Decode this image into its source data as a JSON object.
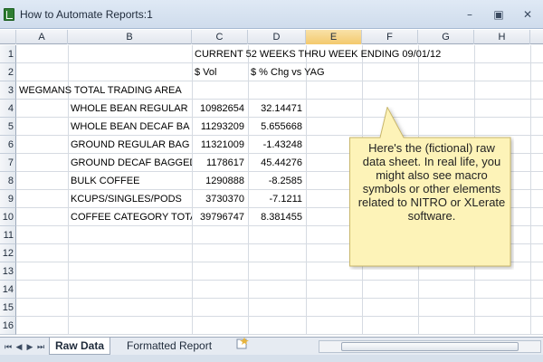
{
  "window": {
    "title": "How to Automate Reports:1",
    "minimize_glyph": "–",
    "restore_glyph": "▣",
    "close_glyph": "✕"
  },
  "columns": [
    "A",
    "B",
    "C",
    "D",
    "E",
    "F",
    "G",
    "H"
  ],
  "selected_column": "E",
  "row_numbers": [
    "1",
    "2",
    "3",
    "4",
    "5",
    "6",
    "7",
    "8",
    "9",
    "10",
    "11",
    "12",
    "13",
    "14",
    "15",
    "16"
  ],
  "cells": {
    "C1": "CURRENT 52 WEEKS THRU WEEK ENDING 09/01/12",
    "C2": "$ Vol",
    "D2": "$ % Chg vs YAG",
    "A3": "WEGMANS TOTAL TRADING AREA",
    "B4": "WHOLE BEAN REGULAR",
    "C4": "10982654",
    "D4": "32.14471",
    "B5": "WHOLE BEAN DECAF BA",
    "C5": "11293209",
    "D5": "5.655668",
    "B6": "GROUND REGULAR BAG",
    "C6": "11321009",
    "D6": "-1.43248",
    "B7": "GROUND DECAF BAGGED",
    "C7": "1178617",
    "D7": "45.44276",
    "B8": "BULK COFFEE",
    "C8": "1290888",
    "D8": "-8.2585",
    "B9": "KCUPS/SINGLES/PODS",
    "C9": "3730370",
    "D9": "-7.1211",
    "B10": "COFFEE CATEGORY TOTAL",
    "C10": "39796747",
    "D10": "8.381455"
  },
  "callout": {
    "text": "Here's the (fictional) raw data sheet.  In real life, you might also see macro symbols or other elements related to NITRO or XLerate software.",
    "fill_color": "#fdf3b8",
    "border_color": "#c8b66a"
  },
  "sheet_tabs": [
    "Raw Data",
    "Formatted Report"
  ],
  "active_sheet": "Raw Data",
  "nav_buttons": [
    "⏮",
    "◀",
    "▶",
    "⏭"
  ],
  "colors": {
    "header_selected": "#f3c96d",
    "gridline": "#d6dbe2"
  }
}
